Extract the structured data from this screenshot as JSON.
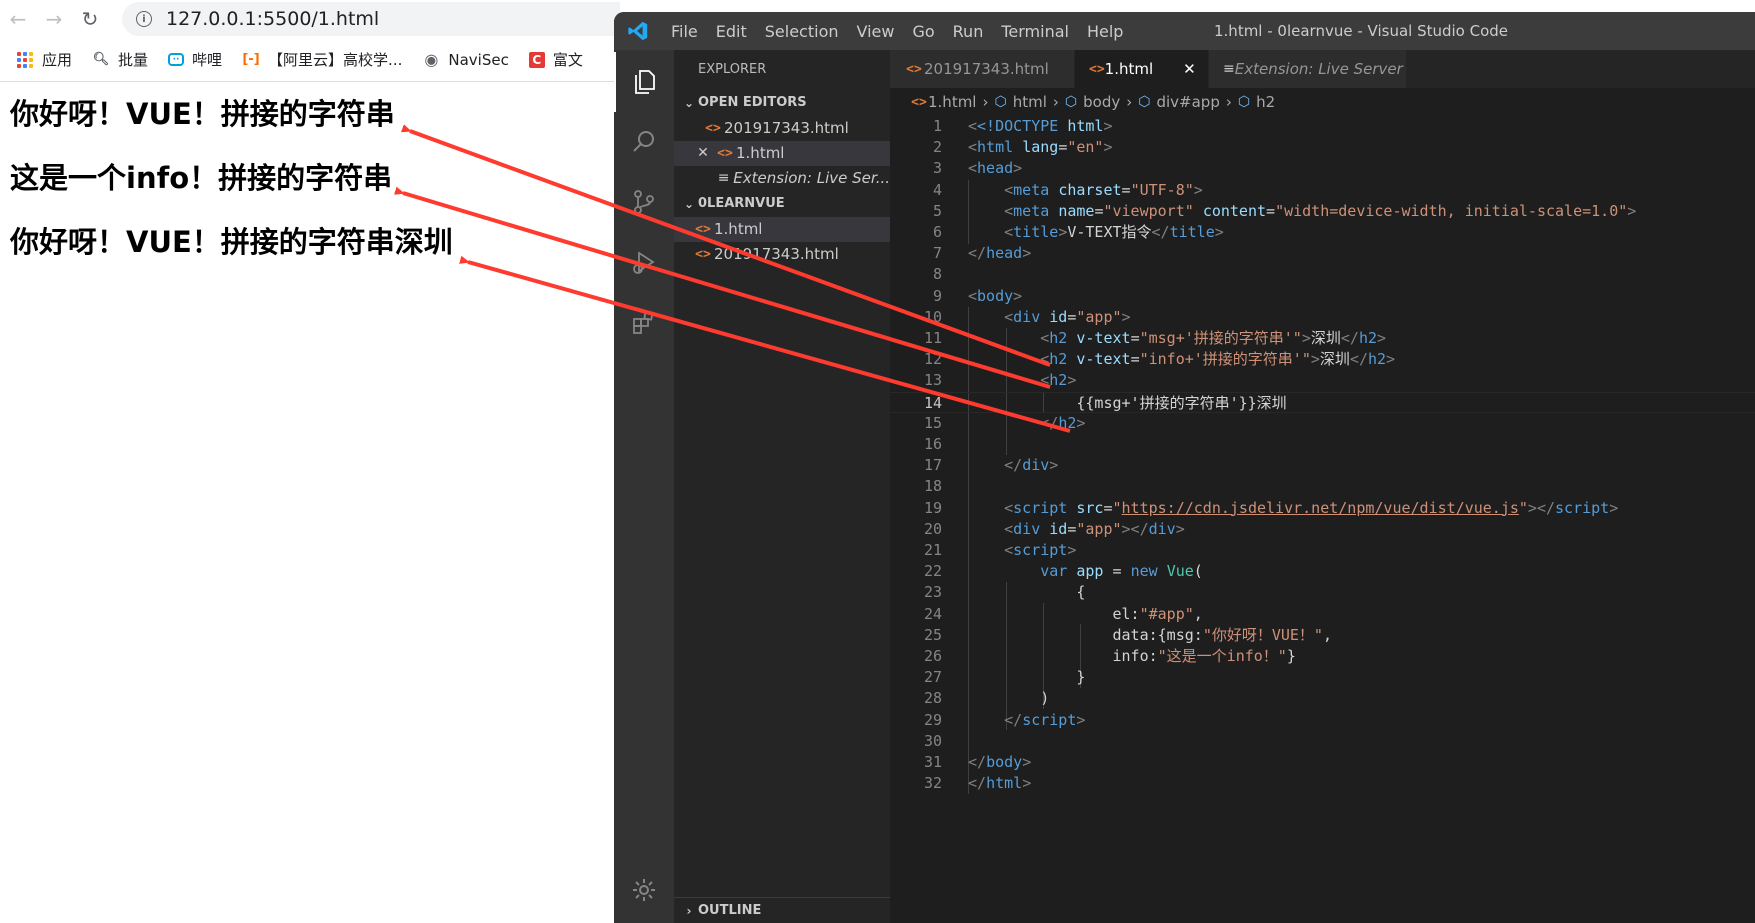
{
  "browser": {
    "url": "127.0.0.1:5500/1.html",
    "bookmarks": [
      {
        "label": "应用",
        "icon": "apps-grid-icon"
      },
      {
        "label": "批量",
        "icon": "search-icon"
      },
      {
        "label": "哔哩",
        "icon": "bilibili-icon"
      },
      {
        "label": "【阿里云】高校学...",
        "icon": "aliyun-icon"
      },
      {
        "label": "NaviSec",
        "icon": "globe-icon"
      },
      {
        "label": "富文",
        "icon": "c-logo-icon"
      }
    ],
    "outputs": [
      "你好呀！VUE！拼接的字符串",
      "这是一个info！拼接的字符串",
      "你好呀！VUE！拼接的字符串深圳"
    ]
  },
  "vscode": {
    "menu": [
      "File",
      "Edit",
      "Selection",
      "View",
      "Go",
      "Run",
      "Terminal",
      "Help"
    ],
    "window_title": "1.html - 0learnvue - Visual Studio Code",
    "sidebar": {
      "title": "EXPLORER",
      "open_editors_label": "OPEN EDITORS",
      "open_editors": [
        "201917343.html",
        "1.html",
        "Extension: Live Ser..."
      ],
      "project_label": "0LEARNVUE",
      "project_files": [
        "1.html",
        "201917343.html"
      ],
      "outline_label": "OUTLINE"
    },
    "tabs": [
      "201917343.html",
      "1.html",
      "Extension: Live Server"
    ],
    "breadcrumb": [
      "1.html",
      "html",
      "body",
      "div#app",
      "h2"
    ],
    "line_numbers": [
      "1",
      "2",
      "3",
      "4",
      "5",
      "6",
      "7",
      "8",
      "9",
      "10",
      "11",
      "12",
      "13",
      "14",
      "15",
      "16",
      "17",
      "18",
      "19",
      "20",
      "21",
      "22",
      "23",
      "24",
      "25",
      "26",
      "27",
      "28",
      "29",
      "30",
      "31",
      "32"
    ],
    "code": {
      "doctype": "<!DOCTYPE",
      "html_kw": "html",
      "lang_value": "\"en\"",
      "charset_value": "\"UTF-8\"",
      "viewport_value": "\"viewport\"",
      "content_value": "\"width=device-width, initial-scale=1.0\"",
      "title_text": "V-TEXT指令",
      "app_value": "\"app\"",
      "vtext1_value": "\"msg+'拼接的字符串'\"",
      "vtext2_value": "\"info+'拼接的字符串'\"",
      "h2_suffix": "深圳",
      "mustache_line": "{{msg+'拼接的字符串'}}深圳",
      "script_src": "https://cdn.jsdelivr.net/npm/vue/dist/vue.js",
      "var_kw": "var",
      "app_var": "app",
      "new_kw": "new",
      "vue_cls": "Vue",
      "el_key": "el:",
      "el_value": "\"#app\"",
      "data_key": "data:{msg:",
      "msg_value": "\"你好呀！VUE！\"",
      "info_key": "info:",
      "info_value": "\"这是一个info！\""
    }
  }
}
